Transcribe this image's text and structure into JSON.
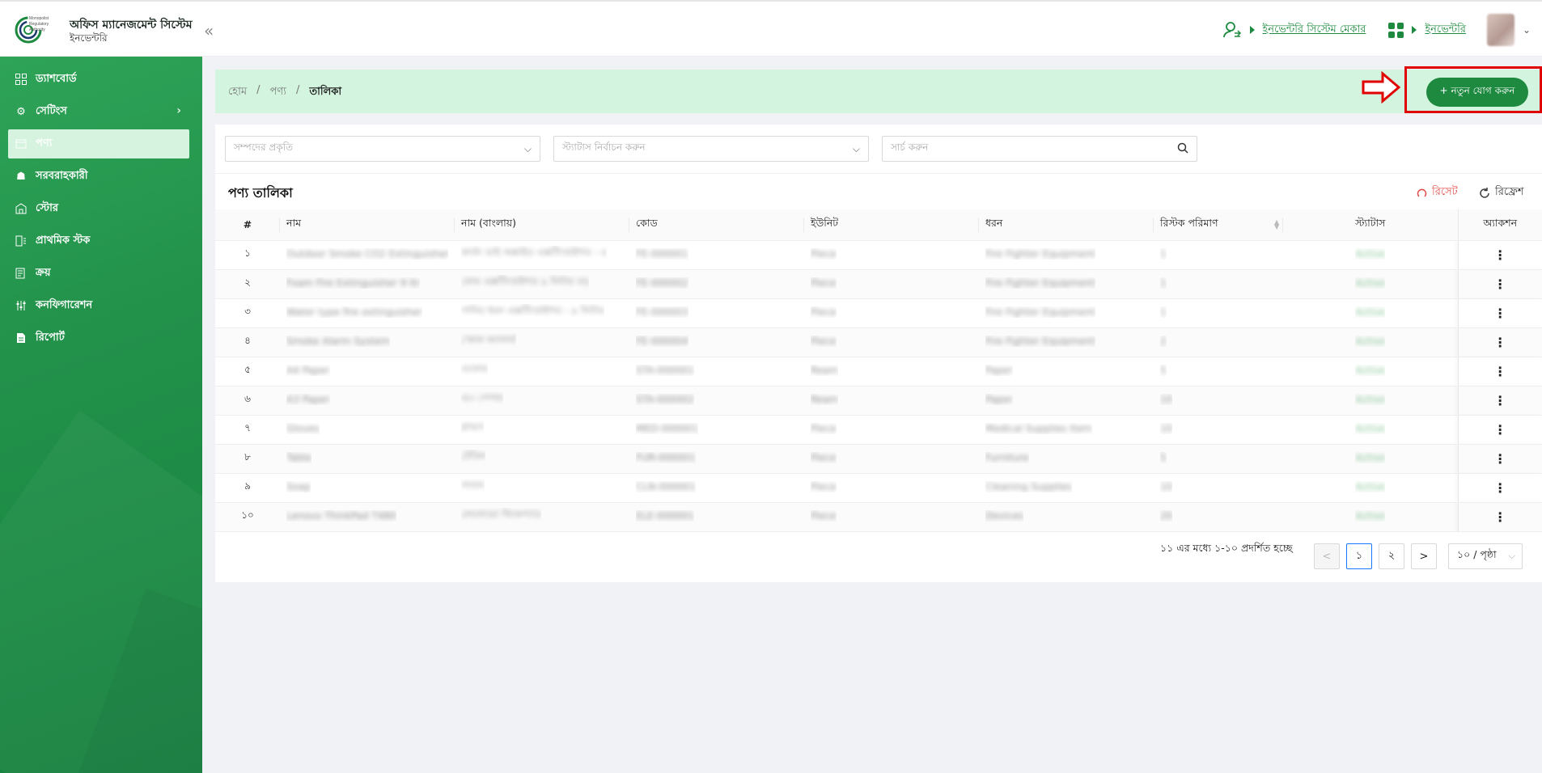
{
  "header": {
    "logo_text": "Monopolist Regulatory Authority",
    "app_title": "অফিস ম্যানেজমেন্ট সিস্টেম",
    "app_subtitle": "ইনভেন্টরি",
    "collapse_icon": "«",
    "system_maker_link": "ইনভেন্টরি সিস্টেম মেকার",
    "module_link": "ইনভেন্টরি"
  },
  "sidebar": {
    "items": [
      {
        "label": "ড্যাশবোর্ড",
        "icon": "dashboard-icon"
      },
      {
        "label": "সেটিংস",
        "icon": "gear-icon"
      },
      {
        "label": "পণ্য",
        "icon": "box-icon"
      },
      {
        "label": "সরবরাহকারী",
        "icon": "supplier-icon"
      },
      {
        "label": "স্টোর",
        "icon": "store-icon"
      },
      {
        "label": "প্রাথমিক স্টক",
        "icon": "stock-icon"
      },
      {
        "label": "ক্রয়",
        "icon": "purchase-icon"
      },
      {
        "label": "কনফিগারেশন",
        "icon": "config-icon"
      },
      {
        "label": "রিপোর্ট",
        "icon": "report-icon"
      }
    ]
  },
  "breadcrumb": {
    "home": "হোম",
    "products": "পণ্য",
    "current": "তালিকা",
    "sep": "/"
  },
  "add_button": "+ নতুন যোগ করুন",
  "filters": {
    "asset_type_placeholder": "সম্পদের প্রকৃতি",
    "status_placeholder": "স্ট্যাটাস নির্বাচন করুন",
    "search_placeholder": "সার্চ করুন"
  },
  "list": {
    "title": "পণ্য তালিকা",
    "reset": "রিসেট",
    "refresh": "রিফ্রেশ",
    "columns": [
      "#",
      "নাম",
      "নাম (বাংলায়)",
      "কোড",
      "ইউনিট",
      "ধরন",
      "রিস্টক পরিমাণ",
      "স্ট্যাটাস",
      "অ্যাকশন"
    ],
    "rows": [
      {
        "no": "১",
        "name": "Outdoor Smoke CO2 Extinguisher",
        "name_bn": "কার্বন ডাই অক্সাইড এক্সটিংগুইশার - ৫",
        "code": "FE-000001",
        "unit": "Piece",
        "type": "Fire Fighter Equipment",
        "restock": "1",
        "status": "Active"
      },
      {
        "no": "২",
        "name": "Foam Fire Extinguisher 9 ltr",
        "name_bn": "ফোম এক্সটিংগুইশার ৯ লিটার বড়",
        "code": "FE-000002",
        "unit": "Piece",
        "type": "Fire Fighter Equipment",
        "restock": "1",
        "status": "Active"
      },
      {
        "no": "৩",
        "name": "Water type fire extinguisher",
        "name_bn": "পানির ধরন এক্সটিংগুইশার - ৯ লিটার",
        "code": "FE-000003",
        "unit": "Piece",
        "type": "Fire Fighter Equipment",
        "restock": "1",
        "status": "Active"
      },
      {
        "no": "৪",
        "name": "Smoke Alarm System",
        "name_bn": "স্মোক অ্যালার্ম",
        "code": "FE-000004",
        "unit": "Piece",
        "type": "Fire Fighter Equipment",
        "restock": "2",
        "status": "Active"
      },
      {
        "no": "৫",
        "name": "A4 Paper",
        "name_bn": "এফোর",
        "code": "STA-000001",
        "unit": "Ream",
        "type": "Paper",
        "restock": "5",
        "status": "Active"
      },
      {
        "no": "৬",
        "name": "A3 Paper",
        "name_bn": "এ৩ পেপার",
        "code": "STA-000002",
        "unit": "Ream",
        "type": "Paper",
        "restock": "10",
        "status": "Active"
      },
      {
        "no": "৭",
        "name": "Gloves",
        "name_bn": "গ্লাভস",
        "code": "MED-000001",
        "unit": "Piece",
        "type": "Medical Supplies Item",
        "restock": "10",
        "status": "Active"
      },
      {
        "no": "৮",
        "name": "Table",
        "name_bn": "টেবিল",
        "code": "FUR-000001",
        "unit": "Piece",
        "type": "Furniture",
        "restock": "5",
        "status": "Active"
      },
      {
        "no": "৯",
        "name": "Soap",
        "name_bn": "সাবান",
        "code": "CLN-000001",
        "unit": "Piece",
        "type": "Cleaning Supplies",
        "restock": "10",
        "status": "Active"
      },
      {
        "no": "১০",
        "name": "Lenovo ThinkPad T480",
        "name_bn": "লেনোভো থিংকপ্যাড",
        "code": "ELE-000001",
        "unit": "Piece",
        "type": "Devices",
        "restock": "20",
        "status": "Active"
      }
    ]
  },
  "pagination": {
    "info": "১১ এর মধ্যে ১-১০ প্রদর্শিত হচ্ছে",
    "prev": "<",
    "pages": [
      "১",
      "২"
    ],
    "next": ">",
    "page_size": "১০ / পৃষ্ঠা"
  },
  "colors": {
    "brand_green": "#1e8a40",
    "sidebar_green": "#22914a",
    "breadcrumb_bg": "#d3f5df",
    "annotation_red": "#e10000"
  }
}
